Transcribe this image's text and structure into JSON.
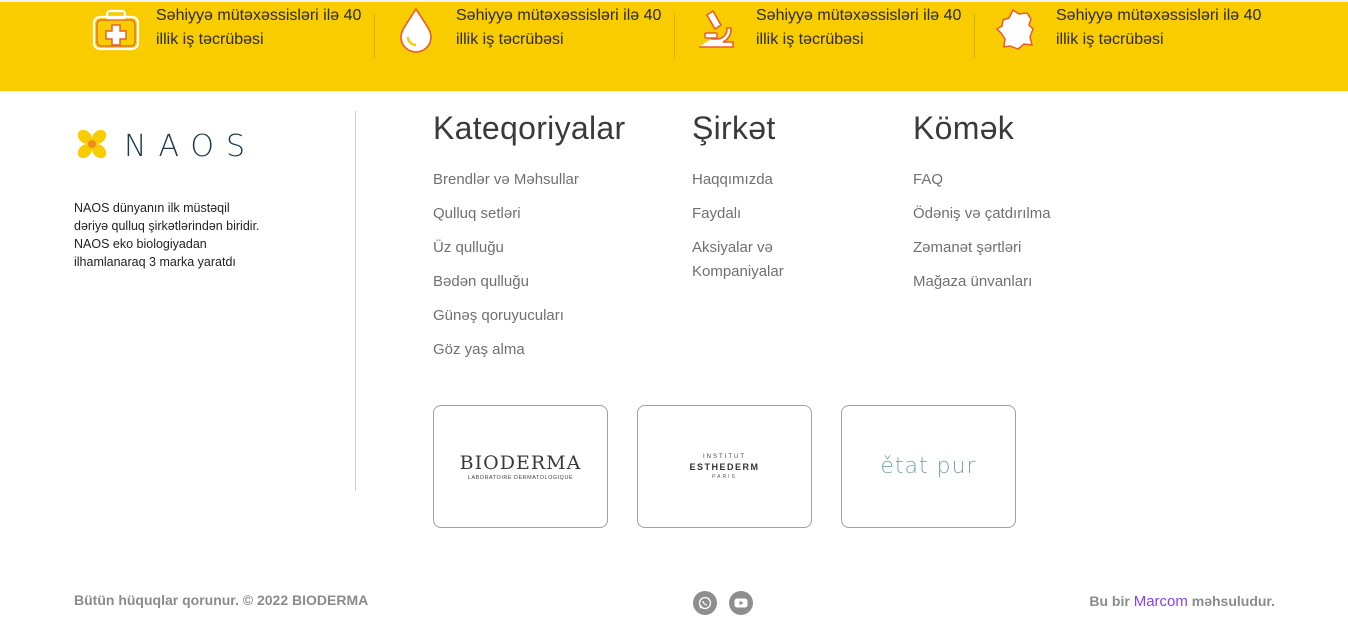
{
  "banner": {
    "features": [
      {
        "icon": "first-aid-kit-icon",
        "text": "Səhiyyə mütəxəssisləri ilə 40 illik iş təcrübəsi"
      },
      {
        "icon": "water-drop-icon",
        "text": "Səhiyyə mütəxəssisləri ilə 40 illik iş təcrübəsi"
      },
      {
        "icon": "microscope-icon",
        "text": "Səhiyyə mütəxəssisləri ilə 40 illik iş təcrübəsi"
      },
      {
        "icon": "france-map-icon",
        "text": "Səhiyyə mütəxəssisləri ilə 40 illik iş təcrübəsi"
      }
    ],
    "background": "#f9cc00"
  },
  "footer": {
    "logo_text": "NAOS",
    "about": "NAOS dünyanın ilk müstəqil dəriyə qulluq şirkətlərindən biridir. NAOS eko biologiyadan ilhamlanaraq 3 marka yaratdı",
    "categories": {
      "title": "Kateqoriyalar",
      "items": [
        "Brendlər və Məhsullar",
        "Qulluq setləri",
        "Üz qulluğu",
        "Bədən qulluğu",
        "Günəş qoruyucuları",
        "Göz yaş alma"
      ]
    },
    "company": {
      "title": "Şirkət",
      "items": [
        "Haqqımızda",
        "Faydalı",
        "Aksiyalar və Kompaniyalar"
      ]
    },
    "help": {
      "title": "Kömək",
      "items": [
        "FAQ",
        "Ödəniş və çatdırılma",
        "Zəmanət şərtləri",
        "Mağaza ünvanları"
      ]
    },
    "brands": {
      "bioderma": {
        "name": "BIODERMA",
        "sub": "LABORATOIRE DERMATOLOGIQUE"
      },
      "esthederm": {
        "top": "INSTITUT",
        "name": "ESTHEDERM",
        "bottom": "PARIS"
      },
      "etatpur": {
        "name": "ětat pur"
      }
    }
  },
  "bottom": {
    "copyright": "Bütün hüquqlar qorunur. © 2022 BIODERMA",
    "credit_prefix": "Bu bir",
    "credit_brand": "Marcom",
    "credit_suffix": "məhsuludur.",
    "accent": "#8a3ff0"
  }
}
